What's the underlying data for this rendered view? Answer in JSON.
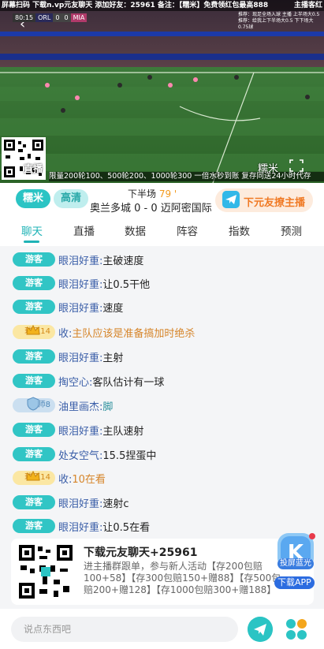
{
  "video": {
    "ticker": "屏幕扫码 下载n.vp元友聊天 添加好友：25961  备注：【糯米】免费领红包最高888",
    "ticker_tail": "主播客红",
    "score_bug": {
      "time": "80:15",
      "home": "ORL",
      "home_score": "0",
      "away_score": "0",
      "away": "MIA"
    },
    "top_note": "推荐：现足全场入球 主播 上半场大0.5\n推荐：给我上下半场大0.5 下下场大0.75球",
    "qr_label": "直播",
    "bottom_ticker": "限量200轮100、500轮200、1000轮300  一倍水秒到账 复存同送24小时代存",
    "watermark": "糯米"
  },
  "info": {
    "room_label": "糯米",
    "hd_label": "高清",
    "half_label": "下半场",
    "minute": "79 '",
    "match": "奥兰多城  0 - 0  迈阿密国际",
    "anchor_button": "下元友撩主播"
  },
  "tabs": [
    "聊天",
    "直播",
    "数据",
    "阵容",
    "指数",
    "预测"
  ],
  "messages": [
    {
      "badge": "游客",
      "type": "guest",
      "user": "眼泪好重:",
      "text": " 主破速度"
    },
    {
      "badge": "游客",
      "type": "guest",
      "user": "眼泪好重:",
      "text": " 让0.5干他"
    },
    {
      "badge": "游客",
      "type": "guest",
      "user": "眼泪好重:",
      "text": " 速度"
    },
    {
      "badge": "球王14",
      "type": "king",
      "user": "收:",
      "text": " 主队应该是准备搞加时绝杀"
    },
    {
      "badge": "游客",
      "type": "guest",
      "user": "眼泪好重:",
      "text": " 主射"
    },
    {
      "badge": "游客",
      "type": "guest",
      "user": "掏空心:",
      "text": " 客队估计有一球"
    },
    {
      "badge": "球师8",
      "type": "master",
      "user": "油里画杰:",
      "text": " 脚"
    },
    {
      "badge": "游客",
      "type": "guest",
      "user": "眼泪好重:",
      "text": " 主队速射"
    },
    {
      "badge": "游客",
      "type": "guest",
      "user": "处女空气:",
      "text": " 15.5捏蛋中"
    },
    {
      "badge": "球王14",
      "type": "king",
      "user": "收:",
      "text": " 10在看"
    },
    {
      "badge": "游客",
      "type": "guest",
      "user": "眼泪好重:",
      "text": " 速射c"
    },
    {
      "badge": "游客",
      "type": "guest",
      "user": "眼泪好重:",
      "text": " 让0.5在看"
    }
  ],
  "promo": {
    "title": "下载元友聊天+25961",
    "desc": "进主播群跟单，参与新人活动【存200包赔100+58】【存300包赔150+赠88】【存500包赔200+赠128】【存1000包赔300+赠188】",
    "float_label1": "投屏蓝光",
    "float_label2": "下载APP"
  },
  "input": {
    "placeholder": "说点东西吧"
  },
  "colors": {
    "teal": "#2bc4c4",
    "orange": "#f07a25",
    "name_blue": "#3a5ea8",
    "gold": "#d6852a"
  },
  "icons": [
    "back-arrow-icon",
    "fullscreen-icon",
    "telegram-icon",
    "send-icon",
    "apps-icon",
    "qr-code-icon",
    "crown-icon",
    "shield-icon"
  ]
}
